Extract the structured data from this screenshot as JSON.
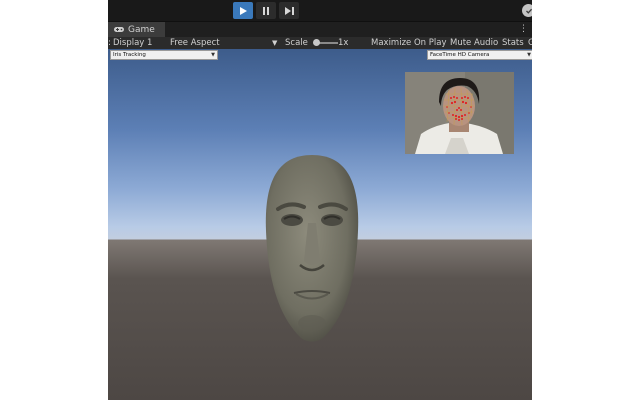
{
  "toolbar": {
    "play_icon": "play-icon",
    "pause_icon": "pause-icon",
    "step_icon": "step-forward-icon",
    "account_icon": "account-check-icon"
  },
  "tabs": {
    "game_label": "Game",
    "game_icon": "gamepad-icon",
    "menu_label": "⋮"
  },
  "gamebar": {
    "display": "Display 1",
    "aspect": "Free Aspect",
    "scale_label": "Scale",
    "scale_value": "1x",
    "maximize": "Maximize On Play",
    "mute": "Mute Audio",
    "stats": "Stats",
    "gizmos_partial": "G"
  },
  "viewport": {
    "mode_dropdown": "Iris Tracking",
    "camera_dropdown": "FaceTime HD Camera"
  },
  "colors": {
    "play_active": "#3a79bb",
    "landmarks": "#e02020",
    "mesh": "#caa23a"
  }
}
